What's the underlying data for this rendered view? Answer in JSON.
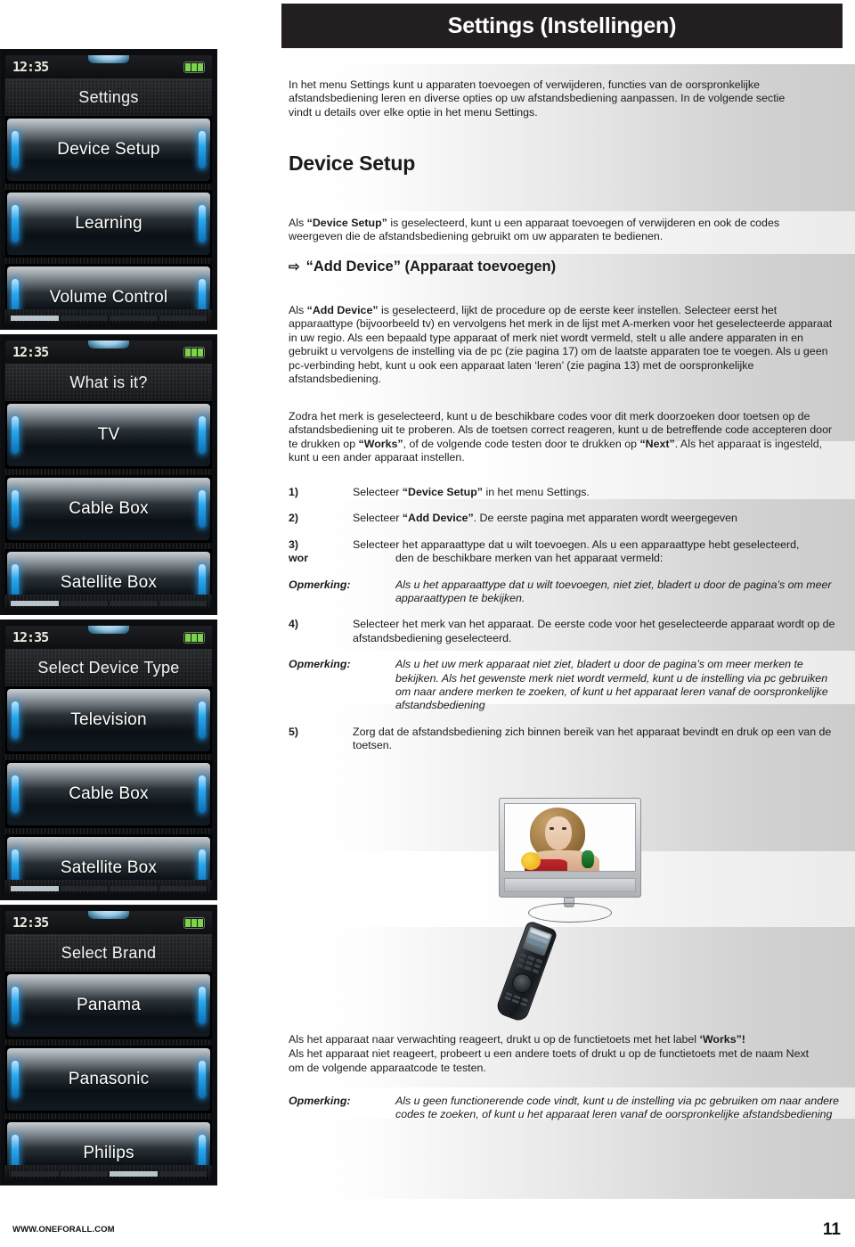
{
  "header": {
    "title": "Settings (Instellingen)"
  },
  "intro": "In het menu Settings kunt u apparaten toevoegen of verwijderen, functies van de oorspronkelijke afstandsbediening leren en diverse opties op uw afstandsbediening aanpassen. In de volgende sectie vindt u details over elke optie in het menu Settings.",
  "section": {
    "heading": "Device Setup",
    "paragraph_prefix": "Als ",
    "paragraph_bold": "“Device Setup”",
    "paragraph_rest": " is geselecteerd, kunt u een apparaat toevoegen of verwijderen en ook de codes weergeven die de afstandsbediening gebruikt om uw apparaten te bedienen."
  },
  "subsection": {
    "arrow_icon": "⇨",
    "heading": "“Add Device” (Apparaat toevoegen)",
    "para1_prefix": "Als ",
    "para1_bold": "“Add Device”",
    "para1_rest": " is geselecteerd, lijkt de procedure op de eerste keer instellen. Selecteer eerst het apparaattype (bijvoorbeeld tv) en vervolgens het merk in de lijst met A-merken voor het geselecteerde apparaat in uw regio. Als een bepaald type apparaat of merk niet wordt vermeld, stelt u alle andere apparaten in en gebruikt u vervolgens de instelling via de pc (zie pagina 17) om de laatste apparaten toe te voegen. Als u geen pc-verbinding hebt, kunt u ook een apparaat laten ‘leren’ (zie pagina 13) met de oorspronkelijke afstandsbediening.",
    "para2_a": "Zodra het merk is geselecteerd, kunt u de beschikbare codes voor dit merk doorzoeken door toetsen op de afstandsbediening uit te proberen. Als de toetsen correct reageren, kunt u de betreffende code accepteren door te drukken op ",
    "para2_bold1": "“Works”",
    "para2_b": ", of de volgende code testen door te drukken op ",
    "para2_bold2": "“Next”",
    "para2_c": ". Als het apparaat is ingesteld, kunt u een ander apparaat instellen."
  },
  "steps": [
    {
      "num": "1)",
      "text_a": "Selecteer ",
      "bold": "“Device Setup”",
      "text_b": " in het menu Settings."
    },
    {
      "num": "2)",
      "text_a": "Selecteer ",
      "bold": "“Add Device”",
      "text_b": ". De eerste pagina met apparaten wordt weergegeven"
    },
    {
      "num": "3)",
      "num_extra": "wor",
      "text_a": "Selecteer het apparaattype dat u wilt toevoegen. Als u een apparaattype hebt geselecteerd, ",
      "text_b": "den de beschikbare merken van het apparaat vermeld:"
    }
  ],
  "notes": [
    {
      "label": "Opmerking:",
      "text": "Als u het apparaattype dat u wilt toevoegen, niet ziet, bladert u door de pagina’s om meer apparaattypen te bekijken."
    },
    {
      "label": "Opmerking:",
      "text": "Als u het uw merk apparaat niet ziet, bladert u door de pagina’s om meer merken te bekijken.  Als het gewenste merk niet wordt vermeld, kunt u de instelling via pc gebruiken om naar andere merken te zoeken, of kunt u het apparaat leren vanaf de oorspronkelijke afstandsbediening"
    }
  ],
  "step4": {
    "num": "4)",
    "text": "Selecteer het merk van het apparaat. De eerste code voor het geselecteerde apparaat wordt op de afstandsbediening geselecteerd."
  },
  "step5": {
    "num": "5)",
    "text": "Zorg dat de afstandsbediening zich binnen bereik van het apparaat bevindt en druk op een van de toetsen."
  },
  "notice": {
    "line1_a": "Als het apparaat naar verwachting reageert, drukt u op de functietoets met het label ",
    "line1_bold": "‘Works”!",
    "line2": "Als het apparaat niet reageert, probeert u een andere toets of drukt u op de functietoets met de naam Next om de volgende apparaatcode te testen."
  },
  "final_note": {
    "label": "Opmerking:",
    "text": "Als u geen functionerende code vindt, kunt u de instelling via pc gebruiken om naar andere codes te zoeken, of kunt u het apparaat leren vanaf de oorspronkelijke afstandsbediening"
  },
  "device_screens": [
    {
      "time": "12:35",
      "title": "Settings",
      "items": [
        "Device Setup",
        "Learning",
        "Volume Control"
      ],
      "page_active": 0
    },
    {
      "time": "12:35",
      "title": "What is it?",
      "items": [
        "TV",
        "Cable Box",
        "Satellite Box"
      ],
      "page_active": 0
    },
    {
      "time": "12:35",
      "title": "Select Device Type",
      "items": [
        "Television",
        "Cable Box",
        "Satellite Box"
      ],
      "page_active": 0
    },
    {
      "time": "12:35",
      "title": "Select Brand",
      "items": [
        "Panama",
        "Panasonic",
        "Philips"
      ],
      "page_active": 2
    }
  ],
  "illustration": {
    "tv_label": "television-with-woman-photo",
    "remote_label": "universal-remote-control"
  },
  "footer": {
    "url": "WWW.ONEFORALL.COM",
    "page_number": "11"
  },
  "colors": {
    "header_bg": "#231f20",
    "accent_blue": "#27a8f0",
    "battery_green": "#7bd44a"
  }
}
